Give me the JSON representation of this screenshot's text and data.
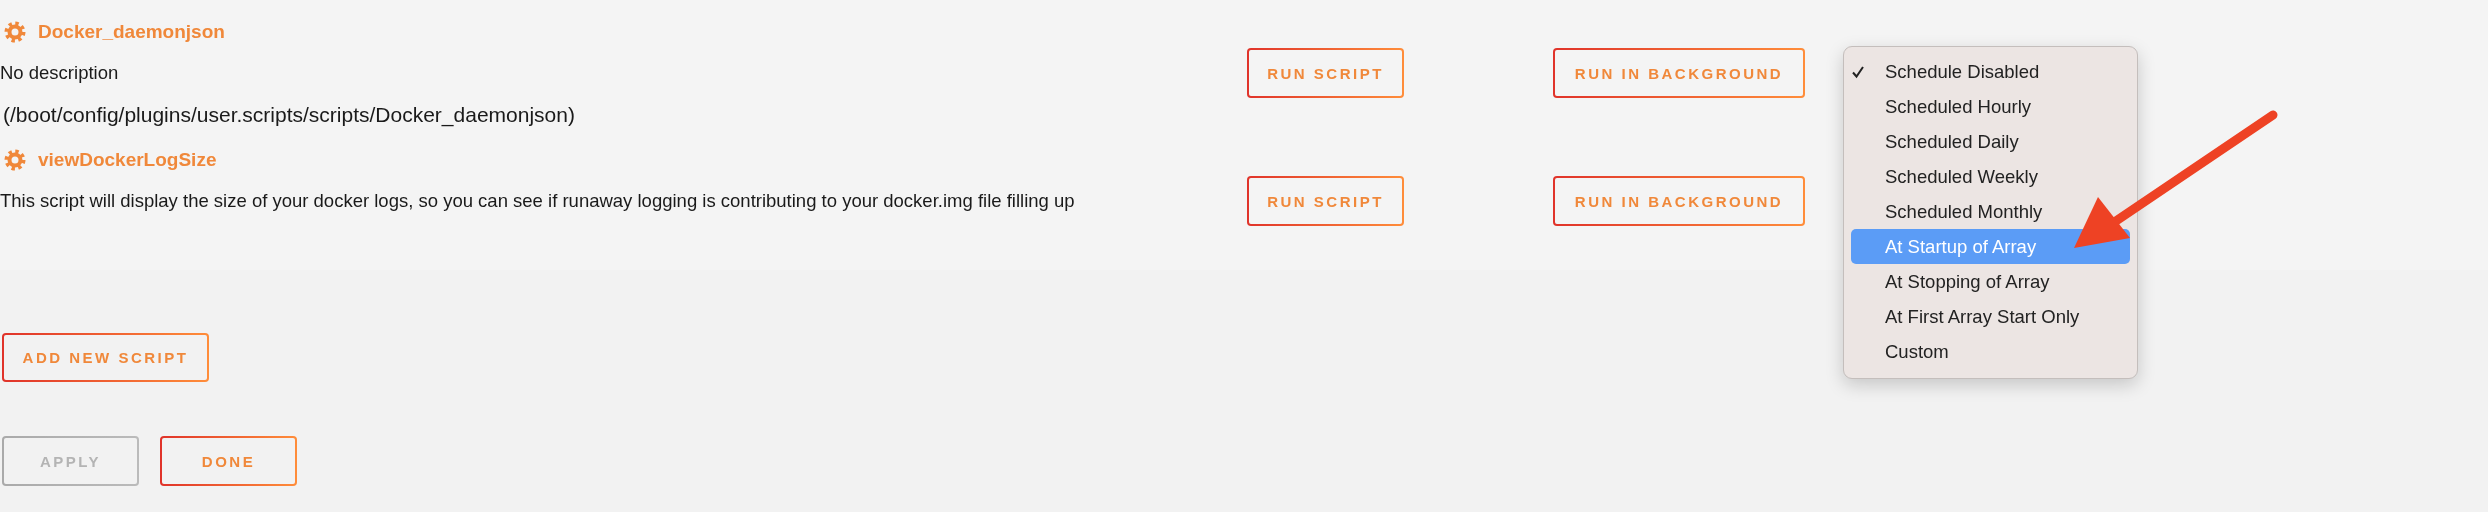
{
  "scripts": [
    {
      "name": "Docker_daemonjson",
      "description": "No description",
      "path": "(/boot/config/plugins/user.scripts/scripts/Docker_daemonjson)",
      "run_label": "RUN SCRIPT",
      "background_label": "RUN IN BACKGROUND"
    },
    {
      "name": "viewDockerLogSize",
      "description": "This script will display the size of your docker logs, so you can see if runaway logging is contributing to your docker.img file filling up",
      "run_label": "RUN SCRIPT",
      "background_label": "RUN IN BACKGROUND"
    }
  ],
  "schedule_menu": {
    "items": [
      {
        "label": "Schedule Disabled",
        "checked": true,
        "selected": false
      },
      {
        "label": "Scheduled Hourly",
        "checked": false,
        "selected": false
      },
      {
        "label": "Scheduled Daily",
        "checked": false,
        "selected": false
      },
      {
        "label": "Scheduled Weekly",
        "checked": false,
        "selected": false
      },
      {
        "label": "Scheduled Monthly",
        "checked": false,
        "selected": false
      },
      {
        "label": "At Startup of Array",
        "checked": false,
        "selected": true
      },
      {
        "label": "At Stopping of Array",
        "checked": false,
        "selected": false
      },
      {
        "label": "At First Array Start Only",
        "checked": false,
        "selected": false
      },
      {
        "label": "Custom",
        "checked": false,
        "selected": false
      }
    ]
  },
  "add_button": {
    "label": "ADD NEW SCRIPT"
  },
  "actions": [
    {
      "label": "APPLY",
      "disabled": true
    },
    {
      "label": "DONE",
      "disabled": false
    }
  ]
}
